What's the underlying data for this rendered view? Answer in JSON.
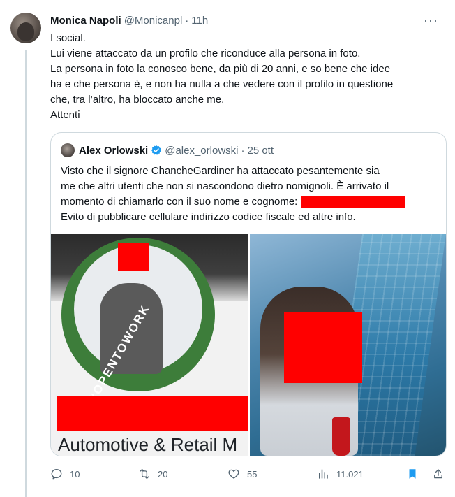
{
  "tweet": {
    "author_name": "Monica Napoli",
    "author_handle": "@Monicanpl",
    "separator": "·",
    "time": "11h",
    "more": "···",
    "lines": [
      "I social.",
      "Lui viene attaccato da un profilo che riconduce alla persona in foto.",
      "La persona in foto la conosco bene, da più di 20 anni, e so bene che idee",
      "ha e che persona è, e non ha nulla a che vedere con il profilo in questione",
      "che, tra l’altro, ha bloccato anche me.",
      "Attenti"
    ]
  },
  "quote": {
    "author_name": "Alex Orlowski",
    "author_handle": "@alex_orlowski",
    "separator": "·",
    "time": "25 ott",
    "lines": [
      "Visto che il signore ChancheGardiner ha attaccato pesantemente sia",
      "me che altri utenti che non si nascondono dietro nomignoli. È arrivato il",
      "momento di chiamarlo con il suo nome e cognome:",
      "Evito di pubblicare cellulare indirizzo codice fiscale ed altre info."
    ],
    "media_left": {
      "badge_text": "#OPENTOWORK",
      "caption": "Automotive & Retail M"
    }
  },
  "actions": {
    "replies": "10",
    "reposts": "20",
    "likes": "55",
    "views": "11.021"
  },
  "colors": {
    "text": "#0f1419",
    "muted": "#536471",
    "border": "#cfd9de",
    "accent": "#1d9bf0",
    "redaction": "#ff0000",
    "badge_green": "#3d7d3a"
  },
  "icons": {
    "reply": "reply-icon",
    "repost": "repost-icon",
    "like": "heart-icon",
    "views": "views-icon",
    "bookmark": "bookmark-icon",
    "share": "share-icon",
    "more": "more-icon",
    "verified": "verified-badge-icon"
  }
}
